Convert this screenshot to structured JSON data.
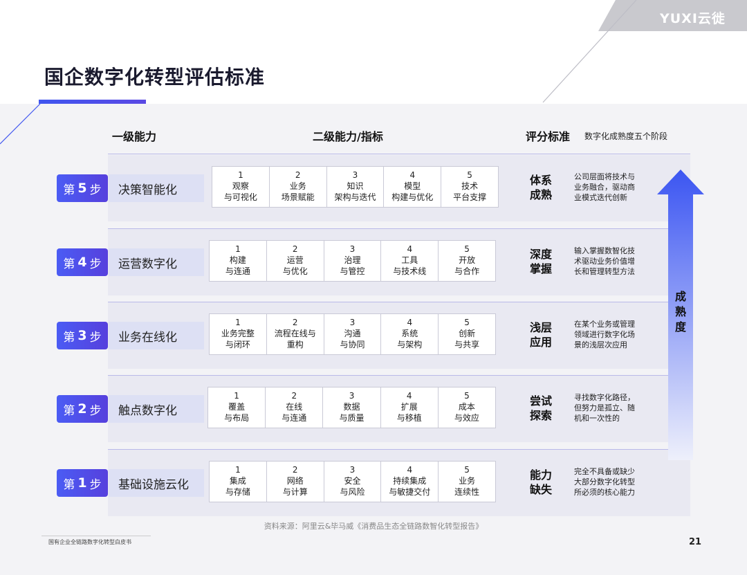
{
  "brand": "YUXI云徙",
  "title": "国企数字化转型评估标准",
  "headers": {
    "level1": "一级能力",
    "level2": "二级能力/指标",
    "grading": "评分标准",
    "grading_sub": "数字化成熟度五个阶段"
  },
  "rows": [
    {
      "step_prefix": "第",
      "step_num": "5",
      "step_suffix": "步",
      "capability": "决策智能化",
      "cells": [
        {
          "num": "1",
          "l1": "观察",
          "l2": "与可视化"
        },
        {
          "num": "2",
          "l1": "业务",
          "l2": "场景赋能"
        },
        {
          "num": "3",
          "l1": "知识",
          "l2": "架构与迭代"
        },
        {
          "num": "4",
          "l1": "模型",
          "l2": "构建与优化"
        },
        {
          "num": "5",
          "l1": "技术",
          "l2": "平台支撑"
        }
      ],
      "grade_l1": "体系",
      "grade_l2": "成熟",
      "desc_l1": "公司层面将技术与",
      "desc_l2": "业务融合，驱动商",
      "desc_l3": "业模式迭代创新"
    },
    {
      "step_prefix": "第",
      "step_num": "4",
      "step_suffix": "步",
      "capability": "运营数字化",
      "cells": [
        {
          "num": "1",
          "l1": "构建",
          "l2": "与连通"
        },
        {
          "num": "2",
          "l1": "运营",
          "l2": "与优化"
        },
        {
          "num": "3",
          "l1": "治理",
          "l2": "与管控"
        },
        {
          "num": "4",
          "l1": "工具",
          "l2": "与技术线"
        },
        {
          "num": "5",
          "l1": "开放",
          "l2": "与合作"
        }
      ],
      "grade_l1": "深度",
      "grade_l2": "掌握",
      "desc_l1": "输入掌握数智化技",
      "desc_l2": "术驱动业务价值增",
      "desc_l3": "长和管理转型方法"
    },
    {
      "step_prefix": "第",
      "step_num": "3",
      "step_suffix": "步",
      "capability": "业务在线化",
      "cells": [
        {
          "num": "1",
          "l1": "业务完整",
          "l2": "与闭环"
        },
        {
          "num": "2",
          "l1": "流程在线与",
          "l2": "重构"
        },
        {
          "num": "3",
          "l1": "沟通",
          "l2": "与协同"
        },
        {
          "num": "4",
          "l1": "系统",
          "l2": "与架构"
        },
        {
          "num": "5",
          "l1": "创新",
          "l2": "与共享"
        }
      ],
      "grade_l1": "浅层",
      "grade_l2": "应用",
      "desc_l1": "在某个业务或管理",
      "desc_l2": "领域进行数字化场",
      "desc_l3": "景的浅层次应用"
    },
    {
      "step_prefix": "第",
      "step_num": "2",
      "step_suffix": "步",
      "capability": "触点数字化",
      "cells": [
        {
          "num": "1",
          "l1": "覆盖",
          "l2": "与布局"
        },
        {
          "num": "2",
          "l1": "在线",
          "l2": "与连通"
        },
        {
          "num": "3",
          "l1": "数据",
          "l2": "与质量"
        },
        {
          "num": "4",
          "l1": "扩展",
          "l2": "与移植"
        },
        {
          "num": "5",
          "l1": "成本",
          "l2": "与效应"
        }
      ],
      "grade_l1": "尝试",
      "grade_l2": "探索",
      "desc_l1": "寻找数字化路径，",
      "desc_l2": "但努力是孤立、随",
      "desc_l3": "机和一次性的"
    },
    {
      "step_prefix": "第",
      "step_num": "1",
      "step_suffix": "步",
      "capability": "基础设施云化",
      "cells": [
        {
          "num": "1",
          "l1": "集成",
          "l2": "与存储"
        },
        {
          "num": "2",
          "l1": "网络",
          "l2": "与计算"
        },
        {
          "num": "3",
          "l1": "安全",
          "l2": "与风险"
        },
        {
          "num": "4",
          "l1": "持续集成",
          "l2": "与敏捷交付"
        },
        {
          "num": "5",
          "l1": "业务",
          "l2": "连续性"
        }
      ],
      "grade_l1": "能力",
      "grade_l2": "缺失",
      "desc_l1": "完全不具备或缺少",
      "desc_l2": "大部分数字化转型",
      "desc_l3": "所必须的核心能力"
    }
  ],
  "arrow_label": [
    "成",
    "熟",
    "度"
  ],
  "source": "资料来源：阿里云&毕马威《消费品生态全链路数智化转型报告》",
  "footer_left": "国有企业全链路数字化转型白皮书",
  "page_number": "21",
  "colors": {
    "accent": "#4b5cf4",
    "accent2": "#5640dd"
  }
}
